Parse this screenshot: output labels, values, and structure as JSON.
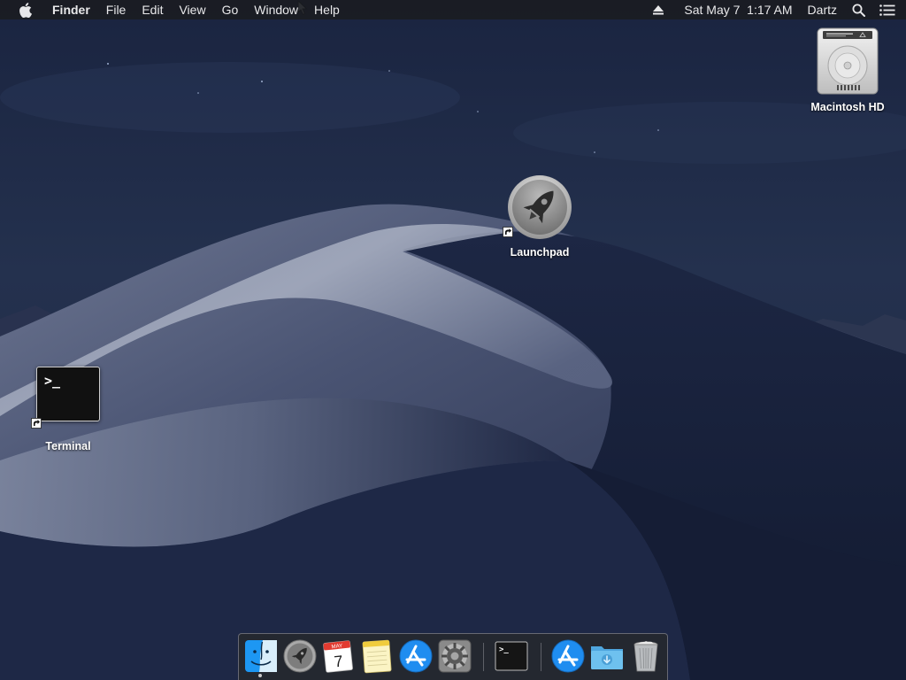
{
  "menubar": {
    "apple_icon": "apple-icon",
    "app_name": "Finder",
    "menus": [
      "File",
      "Edit",
      "View",
      "Go",
      "Window",
      "Help"
    ],
    "status": {
      "eject_icon": "eject-icon",
      "clock": "Sat May 7  1:17 AM",
      "user": "Dartz",
      "spotlight_icon": "spotlight-search-icon",
      "notification_icon": "notification-center-icon"
    }
  },
  "desktop": {
    "icons": [
      {
        "label": "Macintosh HD",
        "icon": "hard-drive-icon"
      },
      {
        "label": "Launchpad",
        "icon": "launchpad-rocket-icon",
        "alias": true
      },
      {
        "label": "Terminal",
        "icon": "terminal-icon",
        "alias": true,
        "prompt": ">_"
      }
    ]
  },
  "dock": {
    "items": [
      {
        "name": "Finder",
        "icon": "finder-icon",
        "running": true
      },
      {
        "name": "Launchpad",
        "icon": "launchpad-rocket-icon"
      },
      {
        "name": "Calendar",
        "icon": "calendar-icon",
        "month": "MAY",
        "day": "7"
      },
      {
        "name": "Notes",
        "icon": "notes-icon"
      },
      {
        "name": "App Store",
        "icon": "app-store-icon"
      },
      {
        "name": "System Preferences",
        "icon": "gear-icon"
      },
      {
        "name": "Terminal",
        "icon": "terminal-icon",
        "prompt": ">_"
      },
      {
        "name": "App Store",
        "icon": "app-store-icon"
      },
      {
        "name": "Downloads",
        "icon": "downloads-folder-icon"
      },
      {
        "name": "Trash",
        "icon": "trash-icon"
      }
    ]
  },
  "colors": {
    "menubar_bg": "#1a1c22",
    "wallpaper_sky": "#1f2a44",
    "dune_light": "#9aa3b8",
    "appstore_blue": "#1f8df0",
    "folder_blue": "#5fb3e8"
  }
}
